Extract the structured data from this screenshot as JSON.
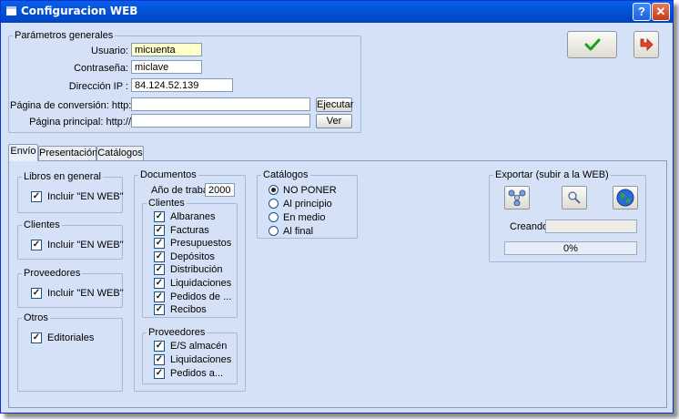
{
  "window": {
    "title": "Configuracion WEB",
    "help_label": "?",
    "close_label": "✕"
  },
  "general": {
    "group_label": "Parámetros generales",
    "usuario_label": "Usuario:",
    "usuario_value": "micuenta",
    "password_label": "Contraseña:",
    "password_value": "miclave",
    "ip_label": "Dirección IP :",
    "ip_value": "84.124.52.139",
    "conversion_label": "Página de conversión: http://",
    "conversion_value": "",
    "principal_label": "Página principal: http://",
    "principal_value": "",
    "ejecutar_label": "Ejecutar",
    "ver_label": "Ver"
  },
  "tabs": [
    {
      "label": "Envío",
      "active": true
    },
    {
      "label": "Presentación",
      "active": false
    },
    {
      "label": "Catálogos",
      "active": false
    }
  ],
  "libros": {
    "group_label": "Libros en general",
    "check_label": "Incluir \"EN WEB\"",
    "checked": true
  },
  "clientes_grp": {
    "group_label": "Clientes",
    "check_label": "Incluir \"EN WEB\"",
    "checked": true
  },
  "proveedores_grp": {
    "group_label": "Proveedores",
    "check_label": "Incluir \"EN WEB\"",
    "checked": true
  },
  "otros": {
    "group_label": "Otros",
    "check_label": "Editoriales",
    "checked": true
  },
  "documentos": {
    "group_label": "Documentos",
    "year_label": "Año de trabajo",
    "year_value": "2000",
    "clientes_label": "Clientes",
    "clientes_items": [
      "Albaranes",
      "Facturas",
      "Presupuestos",
      "Depósitos",
      "Distribución",
      "Liquidaciones",
      "Pedidos de ...",
      "Recibos"
    ],
    "proveedores_label": "Proveedores",
    "proveedores_items": [
      "E/S almacén",
      "Liquidaciones",
      "Pedidos a..."
    ]
  },
  "catalogos": {
    "group_label": "Catálogos",
    "options": [
      "NO PONER",
      "Al principio",
      "En medio",
      "Al final"
    ],
    "selected": "NO PONER"
  },
  "exportar": {
    "group_label": "Exportar (subir a la WEB)",
    "creando_label": "Creando:",
    "progress_text": "0%",
    "progress": 0
  },
  "colors": {
    "accept_check": "#19a019",
    "exit_arrow": "#e8432a",
    "title_bar": "#0353d8"
  }
}
